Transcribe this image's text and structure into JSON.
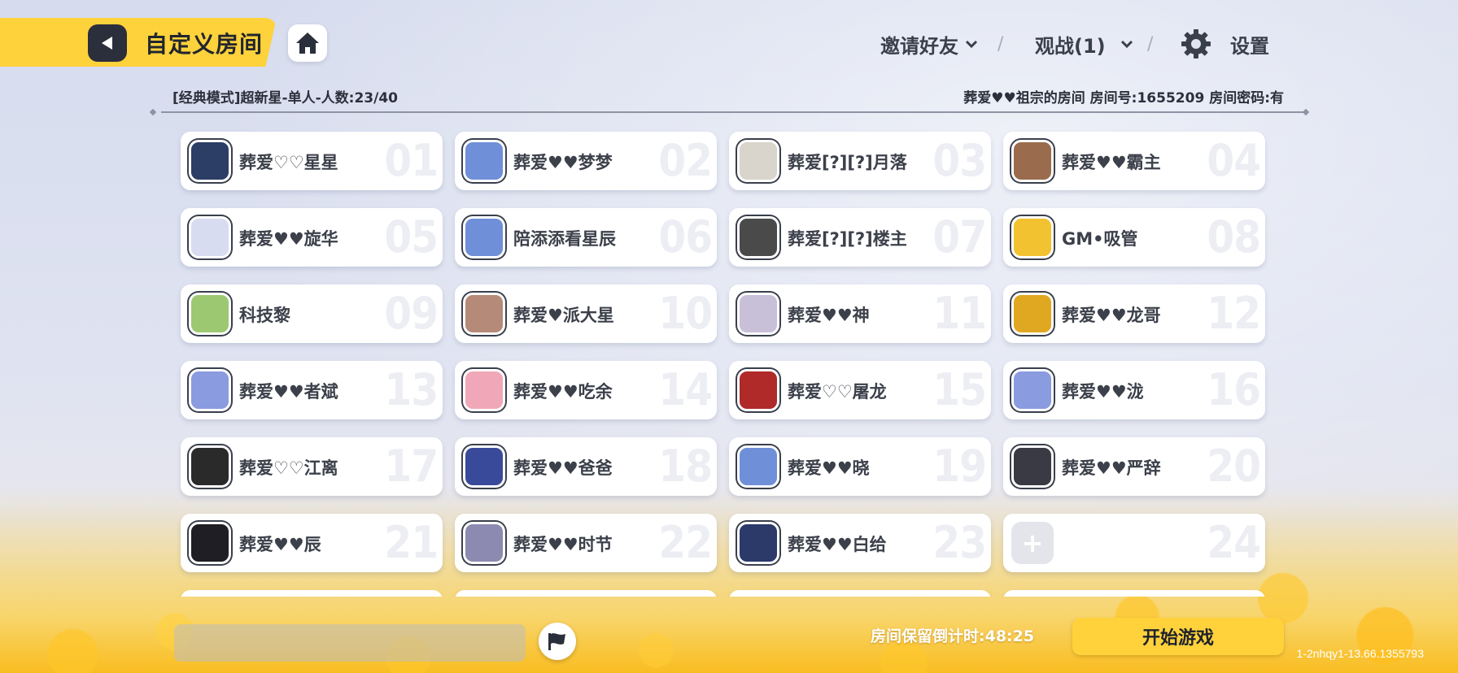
{
  "header": {
    "title": "自定义房间",
    "invite_label": "邀请好友",
    "spectate_label": "观战(1)",
    "settings_label": "设置"
  },
  "room": {
    "mode_info": "[经典模式]超新星-单人-人数:23/40",
    "room_info": "葬爱♥♥祖宗的房间 房间号:1655209 房间密码:有"
  },
  "slots": [
    {
      "num": "01",
      "name": "葬爱♡♡星星",
      "color": "#2c3e66"
    },
    {
      "num": "02",
      "name": "葬爱♥♥梦梦",
      "color": "#6f8fd8"
    },
    {
      "num": "03",
      "name": "葬爱[?][?]月落",
      "color": "#d9d4cc"
    },
    {
      "num": "04",
      "name": "葬爱♥♥霸主",
      "color": "#9a6b4c"
    },
    {
      "num": "05",
      "name": "葬爱♥♥旋华",
      "color": "#d8dcf0"
    },
    {
      "num": "06",
      "name": "陪添添看星辰",
      "color": "#6f8fd8"
    },
    {
      "num": "07",
      "name": "葬爱[?][?]楼主",
      "color": "#4a4a4a"
    },
    {
      "num": "08",
      "name": "GM•吸管",
      "color": "#f2c230"
    },
    {
      "num": "09",
      "name": "科技黎",
      "color": "#9cc872"
    },
    {
      "num": "10",
      "name": "葬爱♥派大星",
      "color": "#b58a78"
    },
    {
      "num": "11",
      "name": "葬爱♥♥神",
      "color": "#c8bfd8"
    },
    {
      "num": "12",
      "name": "葬爱♥♥龙哥",
      "color": "#e0a820"
    },
    {
      "num": "13",
      "name": "葬爱♥♥者斌",
      "color": "#8a9be0"
    },
    {
      "num": "14",
      "name": "葬爱♥♥吃余",
      "color": "#f0a8b8"
    },
    {
      "num": "15",
      "name": "葬爱♡♡屠龙",
      "color": "#b02a2a"
    },
    {
      "num": "16",
      "name": "葬爱♥♥泷",
      "color": "#8a9be0"
    },
    {
      "num": "17",
      "name": "葬爱♡♡江离",
      "color": "#2a2a2a"
    },
    {
      "num": "18",
      "name": "葬爱♥♥爸爸",
      "color": "#3a4a9a"
    },
    {
      "num": "19",
      "name": "葬爱♥♥晓",
      "color": "#6f8fd8"
    },
    {
      "num": "20",
      "name": "葬爱♥♥严辞",
      "color": "#3a3a44"
    },
    {
      "num": "21",
      "name": "葬爱♥♥辰",
      "color": "#1e1e24"
    },
    {
      "num": "22",
      "name": "葬爱♥♥时节",
      "color": "#8c8ab0"
    },
    {
      "num": "23",
      "name": "葬爱♥♥白给",
      "color": "#2c3a6a"
    },
    {
      "num": "24",
      "name": "",
      "empty": true,
      "color": "#e3e5ea"
    }
  ],
  "footer": {
    "countdown": "房间保留倒计时:48:25",
    "start_label": "开始游戏",
    "version": "1-2nhqy1-13.66.1355793"
  },
  "colors": {
    "accent": "#fdd23b",
    "dark": "#2b2f3c"
  }
}
